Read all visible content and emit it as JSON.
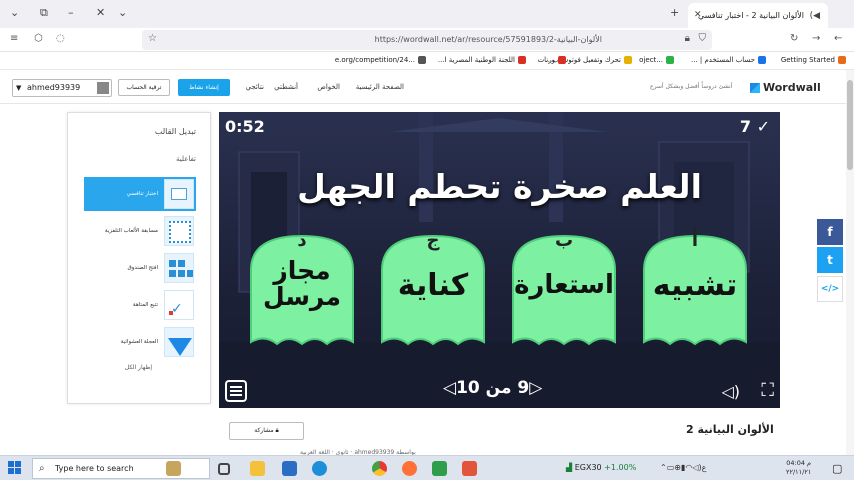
{
  "browser": {
    "tab_title": "الألوان البيانية 2 - اختبار تنافسي",
    "url": "https://wordwall.net/ar/resource/57591893/2-الألوان-البيانية",
    "bookmarks": [
      {
        "label": "Getting Started",
        "color": "#e86a1b"
      },
      {
        "label": "حساب المستخدم | ...",
        "color": "#1a73e8"
      },
      {
        "label": "...oject",
        "color": "#2bb34a"
      },
      {
        "label": "تحرك وتفعيل فوتوشوب...",
        "color": "#e8b000"
      },
      {
        "label": "ورنات",
        "color": "#d93025"
      },
      {
        "label": "اللجنة الوطنية المصرية ا...",
        "color": "#d93025"
      },
      {
        "label": "...e.org/competition/24",
        "color": "#555555"
      }
    ]
  },
  "site": {
    "logo": "Wordwall",
    "tagline": "أنشئ دروساً أفضل وبشكل أسرع",
    "nav": [
      "الصفحة الرئيسية",
      "الخواص",
      "أنشطتي",
      "نتائجي"
    ],
    "create_button": "إنشاء نشاط",
    "upgrade_button": "ترقية الحساب",
    "username": "ahmed93939"
  },
  "left_panel": {
    "title": "تبديل القالب",
    "subtitle": "تفاعلية",
    "templates": [
      {
        "label": "اختبار تنافسي",
        "selected": true
      },
      {
        "label": "مسابقة الألعاب التلفزية",
        "selected": false
      },
      {
        "label": "افتح الصندوق",
        "selected": false
      },
      {
        "label": "تتبع المتاهة",
        "selected": false
      },
      {
        "label": "العجلة العشوائية",
        "selected": false
      }
    ],
    "show_all": "إظهار الكل"
  },
  "game": {
    "timer": "0:52",
    "score": "7",
    "question": "العلم صخرة تحطم الجهل",
    "answers": [
      {
        "letter": "أ",
        "text": "تشبيه"
      },
      {
        "letter": "ب",
        "text": "استعارة"
      },
      {
        "letter": "ج",
        "text": "كناية"
      },
      {
        "letter": "د",
        "text": "مجاز مرسل"
      }
    ],
    "pager": "9 من 10"
  },
  "share_side": [
    {
      "icon": "facebook-icon",
      "glyph": "f",
      "color": "#3b5998"
    },
    {
      "icon": "twitter-icon",
      "glyph": "t",
      "color": "#1da1f2"
    },
    {
      "icon": "embed-icon",
      "glyph": "</>",
      "color": "#ffffff"
    }
  ],
  "resource": {
    "title": "الألوان البيانية 2",
    "share_button": "مشاركة",
    "meta": "بواسطة ahmed93939 · ثانوي · اللغة العربية"
  },
  "taskbar": {
    "search_placeholder": "Type here to search",
    "stock_name": "EGX30",
    "stock_change": "+1.00%",
    "time": "04:04 م",
    "date": "٢٢/١١/٢١"
  },
  "colors": {
    "accent": "#1aa3e8",
    "ghost": "#7ef0a2"
  }
}
